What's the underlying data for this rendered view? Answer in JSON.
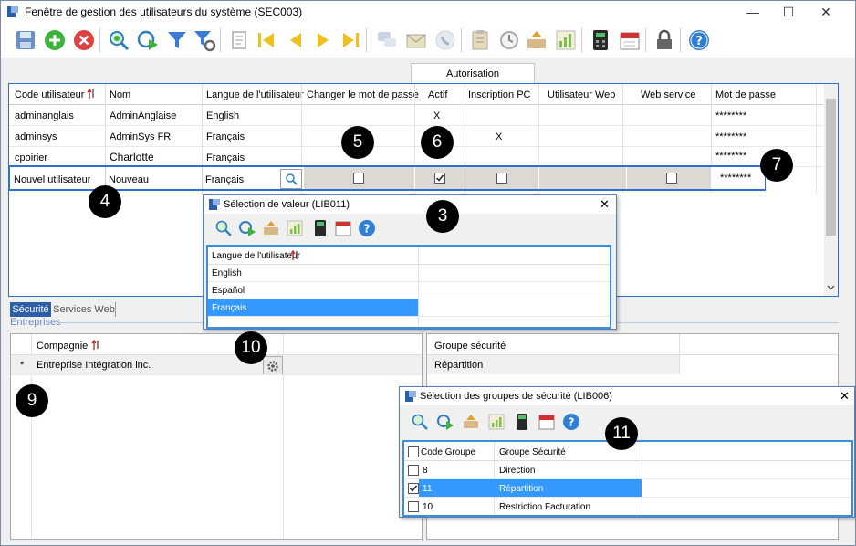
{
  "window": {
    "title": "Fenêtre de gestion des utilisateurs du système (SEC003)",
    "controls": {
      "minimize": "—",
      "maximize": "☐",
      "close": "✕"
    }
  },
  "toolbar": {
    "icons": [
      "save-icon",
      "add-icon",
      "delete-icon",
      "search-icon",
      "refresh-icon",
      "filter-icon",
      "filter-settings-icon",
      "scroll-icon",
      "first-icon",
      "prev-icon",
      "next-icon",
      "last-icon",
      "chat-icon",
      "email-icon",
      "phone-icon",
      "clipboard-icon",
      "history-icon",
      "export-icon",
      "chart-icon",
      "calculator-icon",
      "calendar-icon",
      "lock-icon",
      "help-icon"
    ]
  },
  "users_grid": {
    "group_header": "Autorisation",
    "columns": [
      "Code utilisateur",
      "Nom",
      "Langue de l'utilisateur",
      "Changer le mot de passe",
      "Actif",
      "Inscription  PC",
      "Utilisateur Web",
      "Web service",
      "Mot de passe"
    ],
    "rows": [
      {
        "code": "adminanglais",
        "nom": "AdminAnglaise",
        "langue": "English",
        "changer": "",
        "actif": "X",
        "inscription": "",
        "web": "",
        "ws": "",
        "mdp": "********"
      },
      {
        "code": "adminsys",
        "nom": "AdminSys FR",
        "langue": "Français",
        "changer": "",
        "actif": "",
        "inscription": "X",
        "web": "",
        "ws": "",
        "mdp": "********"
      },
      {
        "code": "cpoirier",
        "nom": "Charlotte",
        "langue": "Français",
        "changer": "",
        "actif": "",
        "inscription": "",
        "web": "",
        "ws": "",
        "mdp": "********"
      }
    ],
    "new_row": {
      "code": "Nouvel utilisateur",
      "nom": "Nouveau",
      "langue": "Français",
      "mdp": "********",
      "actif_checked": true
    }
  },
  "lookup_language": {
    "title": "Sélection de valeur (LIB011)",
    "column": "Langue de l'utilisateur",
    "options": [
      "English",
      "Español",
      "Français"
    ],
    "selected": "Français"
  },
  "tabs": {
    "security": "Sécurité",
    "web_services": "Services Web"
  },
  "companies": {
    "section": "Entreprises",
    "column": "Compagnie",
    "row_marker": "*",
    "rows": [
      "Entreprise Intégration inc."
    ]
  },
  "security_groups_panel": {
    "column": "Groupe sécurité",
    "rows": [
      "Répartition"
    ]
  },
  "security_dialog": {
    "title": "Sélection des groupes de sécurité (LIB006)",
    "columns": [
      "Code Groupe",
      "Groupe Sécurité"
    ],
    "rows": [
      {
        "code": "8",
        "name": "Direction",
        "checked": false
      },
      {
        "code": "11",
        "name": "Répartition",
        "checked": true
      },
      {
        "code": "10",
        "name": "Restriction Facturation",
        "checked": false
      }
    ]
  },
  "callouts": [
    "3",
    "4",
    "5",
    "6",
    "7",
    "9",
    "10",
    "11"
  ],
  "colors": {
    "accent": "#3399ff",
    "frame": "#2f6fcf",
    "callout": "#000000"
  }
}
